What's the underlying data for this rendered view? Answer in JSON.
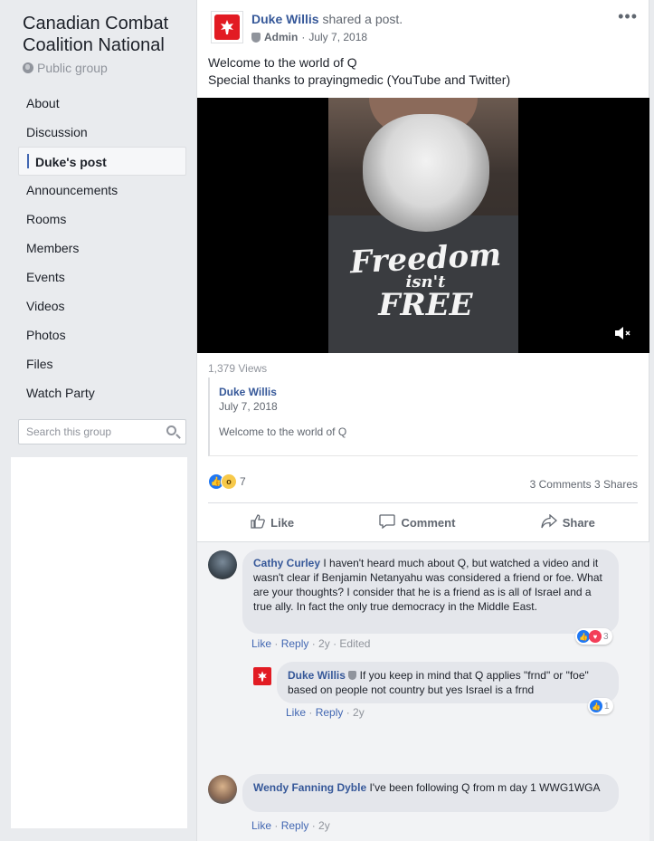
{
  "group": {
    "title": "Canadian Combat Coalition National",
    "privacy": "Public group"
  },
  "nav": {
    "items": [
      "About",
      "Discussion",
      "Duke's post",
      "Announcements",
      "Rooms",
      "Members",
      "Events",
      "Videos",
      "Photos",
      "Files",
      "Watch Party"
    ],
    "active_index": 2
  },
  "search": {
    "placeholder": "Search this group"
  },
  "post": {
    "author": "Duke Willis",
    "action": "shared a post.",
    "role": "Admin",
    "date": "July 7, 2018",
    "line1": "Welcome to the world of Q",
    "line2": "Special thanks to prayingmedic (YouTube and Twitter)",
    "more_icon": "more-icon",
    "video": {
      "shirt_line1": "Freedom",
      "shirt_line2": "isn't",
      "shirt_line3": "FREE",
      "mute_icon": "volume-muted-icon"
    },
    "views": "1,379 Views",
    "quoted": {
      "author": "Duke Willis",
      "date": "July 7, 2018",
      "text": "Welcome to the world of Q"
    },
    "reaction_count": "7",
    "comments_count": "3 Comments",
    "shares_count": "3 Shares",
    "actions": {
      "like": "Like",
      "comment": "Comment",
      "share": "Share"
    }
  },
  "comments": [
    {
      "name": "Cathy Curley",
      "text": "I haven't heard much about Q, but watched a video and it wasn't clear if Benjamin Netanyahu was considered a friend or foe. What are your thoughts? I consider that he is a friend as is all of Israel and a true ally. In fact the only true democracy in the Middle East.",
      "like": "Like",
      "reply": "Reply",
      "time": "2y",
      "edited": "Edited",
      "reactions": "3"
    },
    {
      "name": "Duke Willis",
      "text": "If you keep in mind that Q applies \"frnd\" or \"foe\" based on people not country but yes Israel is a frnd",
      "like": "Like",
      "reply": "Reply",
      "time": "2y",
      "reactions": "1"
    },
    {
      "name": "Wendy Fanning Dyble",
      "text": "I've been following Q from m day 1 WWG1WGA",
      "like": "Like",
      "reply": "Reply",
      "time": "2y"
    }
  ],
  "colors": {
    "link": "#365899",
    "accent": "#4267b2",
    "logo_red": "#e21b23"
  }
}
